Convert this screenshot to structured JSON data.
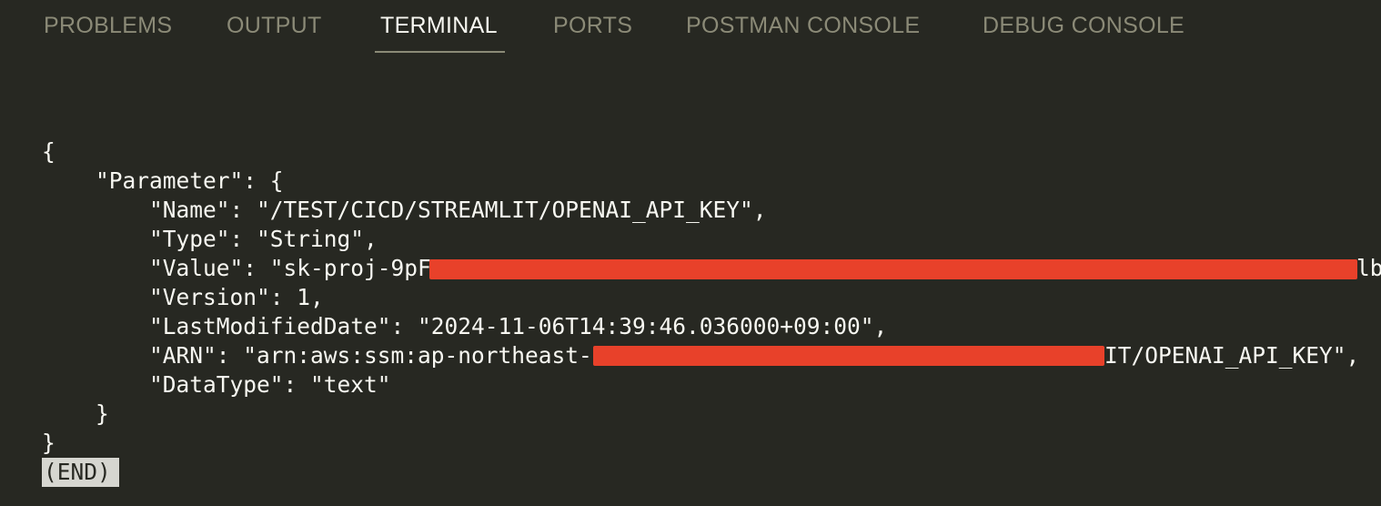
{
  "tabs": {
    "problems": "PROBLEMS",
    "output": "OUTPUT",
    "terminal": "TERMINAL",
    "ports": "PORTS",
    "postman_console": "POSTMAN CONSOLE",
    "debug_console": "DEBUG CONSOLE",
    "active": "TERMINAL"
  },
  "terminal": {
    "lines": [
      "{",
      "    \"Parameter\": {",
      "        \"Name\": \"/TEST/CICD/STREAMLIT/OPENAI_API_KEY\",",
      "        \"Type\": \"String\",",
      "        \"Value\": \"sk-proj-9pF-",
      "        \"Version\": 1,",
      "        \"LastModifiedDate\": \"2024-11-06T14:39:46.036000+09:00\",",
      "        \"ARN\": \"arn:aws:ssm:ap-northeast-2:",
      "        \"DataType\": \"text\"",
      "    }",
      "}"
    ],
    "value_line_suffix": "lb",
    "arn_line_suffix": "IT/OPENAI_API_KEY\",",
    "pager_end": "(END)"
  },
  "colors": {
    "background": "#272822",
    "text": "#f8f8f2",
    "inactive_tab": "#8b8a77",
    "redaction": "#e8412a",
    "end_marker_bg": "#d6d6d0"
  }
}
